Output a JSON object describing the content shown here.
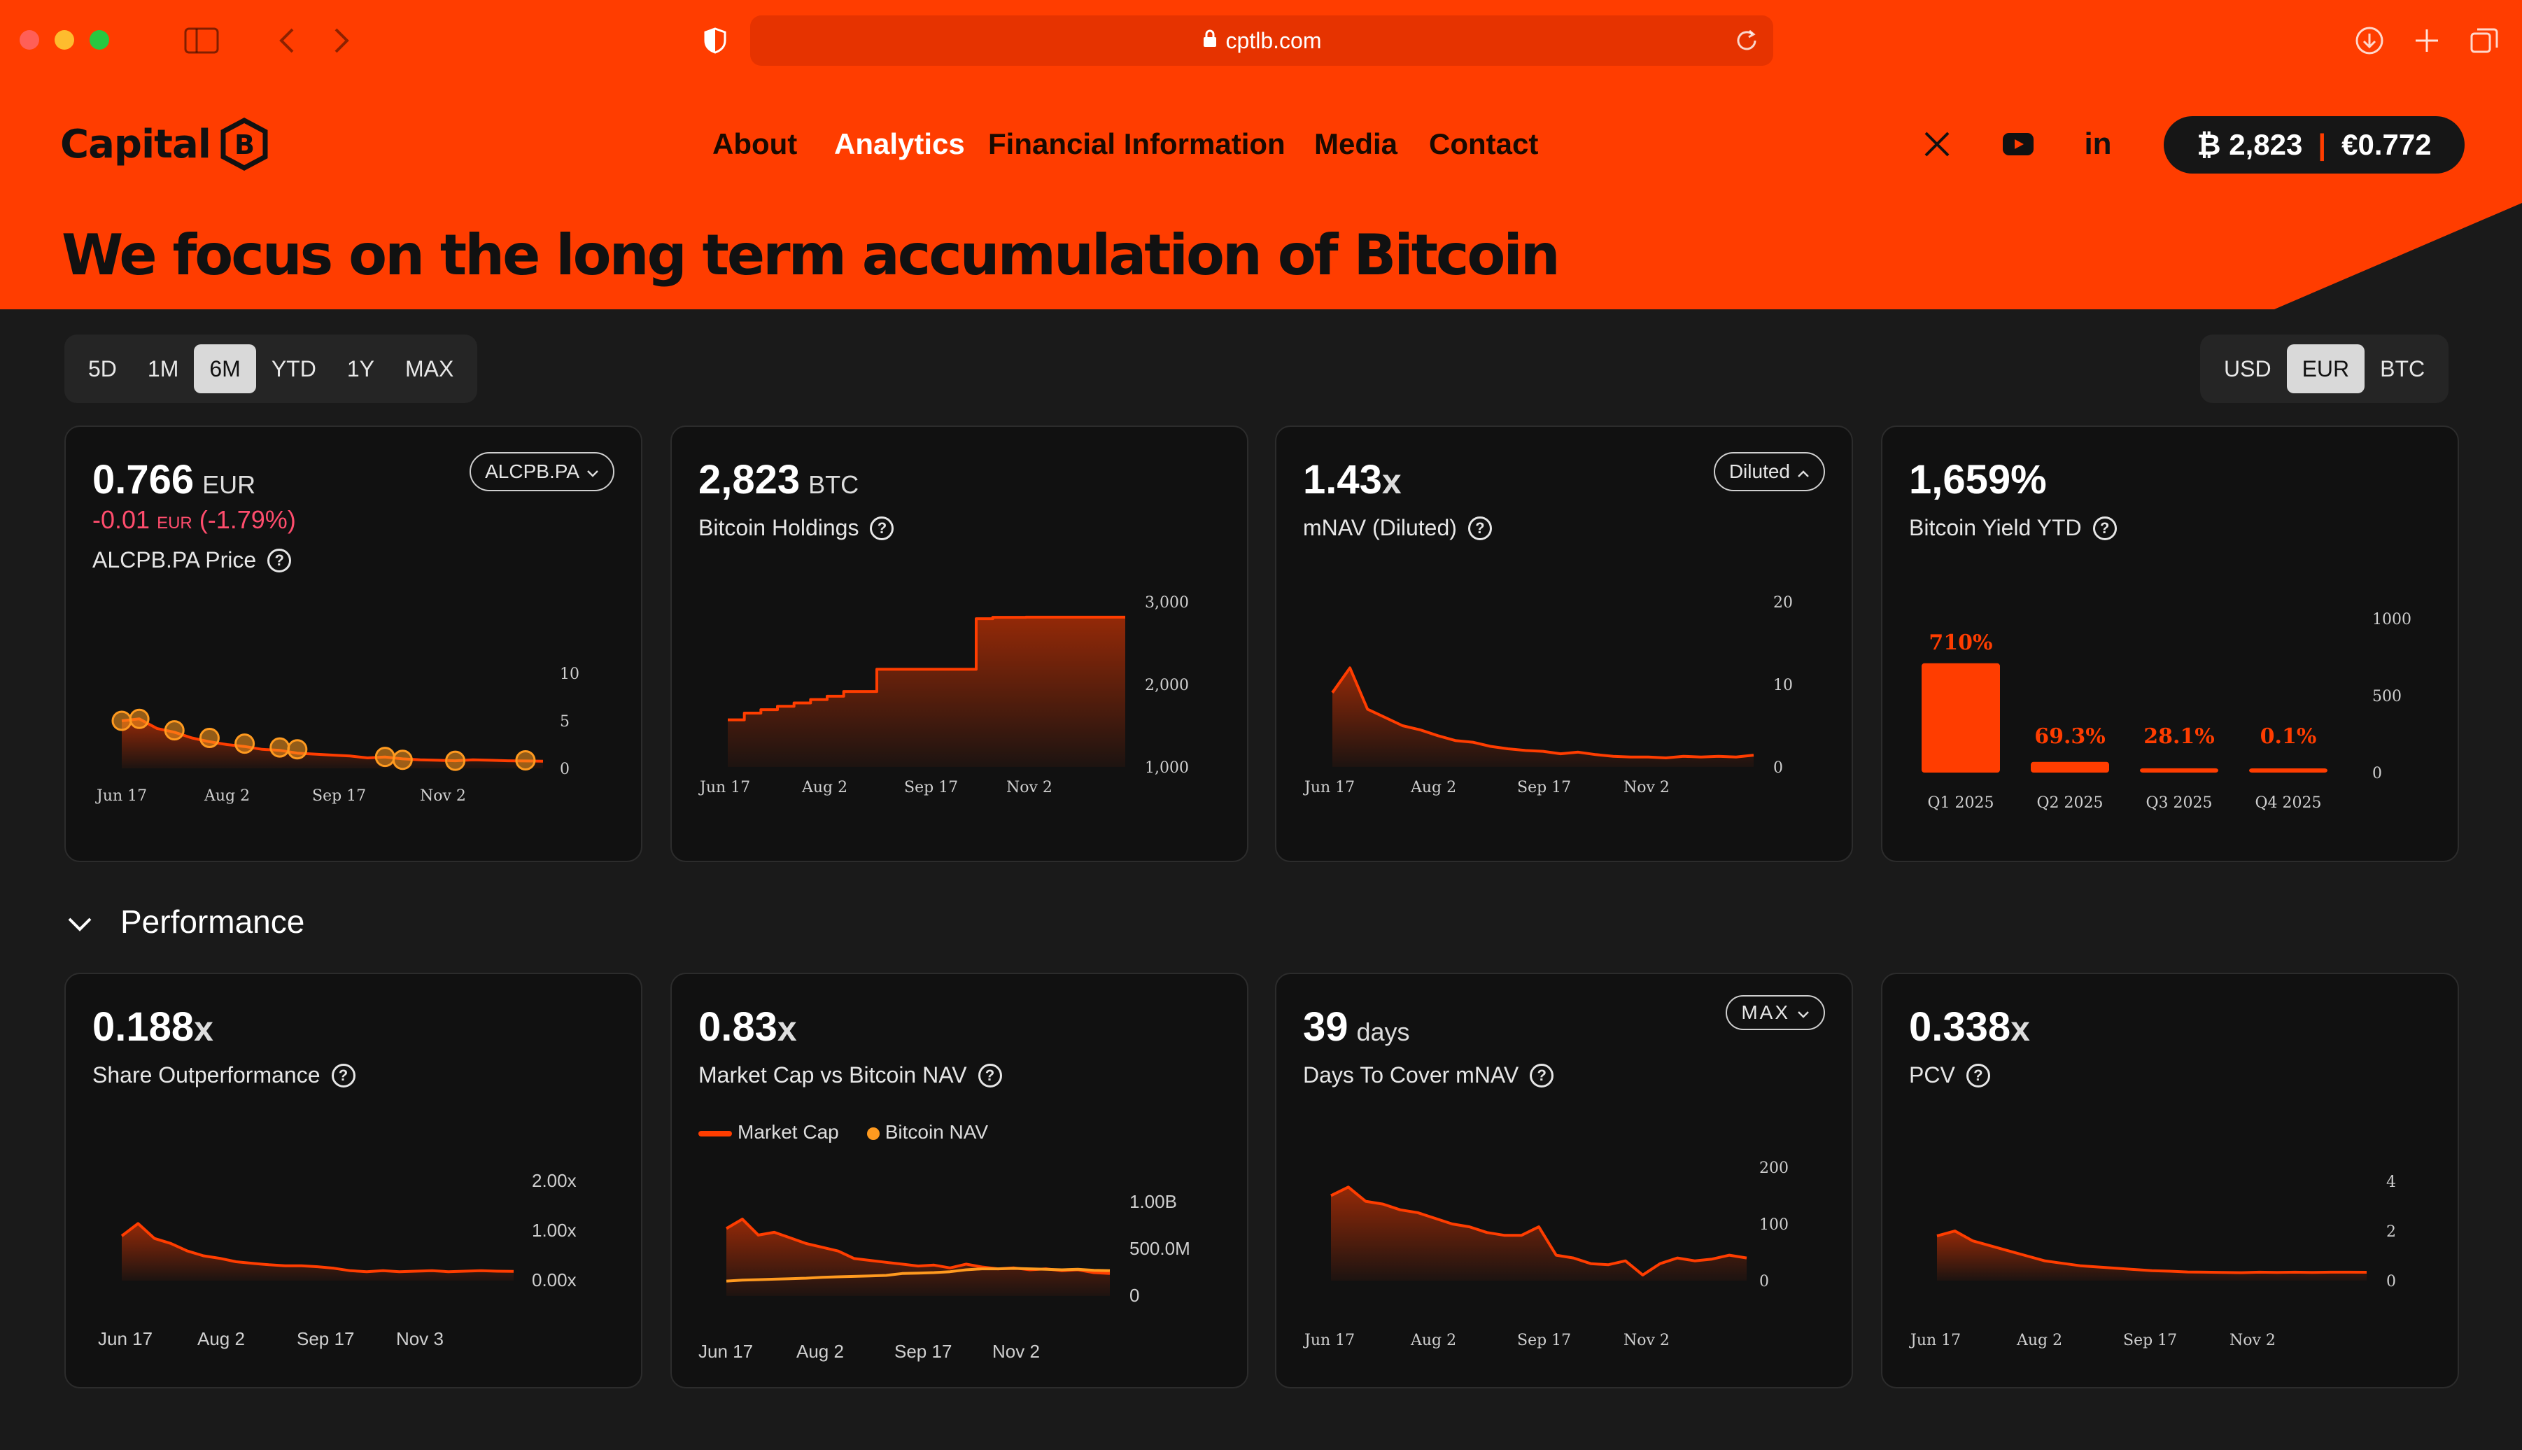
{
  "browser": {
    "url": "cptlb.com"
  },
  "header": {
    "logo": "Capital",
    "nav": [
      {
        "label": "About",
        "active": false
      },
      {
        "label": "Analytics",
        "active": true
      },
      {
        "label": "Financial Information",
        "active": false
      },
      {
        "label": "Media",
        "active": false
      },
      {
        "label": "Contact",
        "active": false
      }
    ],
    "social": [
      "x-icon",
      "youtube-icon",
      "linkedin-icon"
    ],
    "ticker": {
      "btc": "₿ 2,823",
      "price": "€0.772"
    },
    "headline": "We focus on the long term accumulation of Bitcoin"
  },
  "periods": [
    "5D",
    "1M",
    "6M",
    "YTD",
    "1Y",
    "MAX"
  ],
  "period_selected": "6M",
  "currencies": [
    "USD",
    "EUR",
    "BTC"
  ],
  "currency_selected": "EUR",
  "colors": {
    "accent": "#ff3d00",
    "background": "#1a1a1a",
    "card": "#111111",
    "negative": "#ff4d6d",
    "secondary_series": "#ff9a1f"
  },
  "cards": {
    "price": {
      "value": "0.766",
      "unit": "EUR",
      "change_value": "-0.01",
      "change_unit": "EUR",
      "change_pct": "(-1.79%)",
      "label": "ALCPB.PA Price",
      "chip": "ALCPB.PA"
    },
    "holdings": {
      "value": "2,823",
      "unit": "BTC",
      "label": "Bitcoin Holdings"
    },
    "mnav": {
      "value": "1.43",
      "unit": "x",
      "label": "mNAV (Diluted)",
      "chip": "Diluted"
    },
    "yield": {
      "value": "1,659%",
      "label": "Bitcoin Yield YTD"
    },
    "outperf": {
      "value": "0.188",
      "unit": "x",
      "label": "Share Outperformance"
    },
    "mcap": {
      "value": "0.83",
      "unit": "x",
      "label": "Market Cap vs Bitcoin NAV",
      "legend": [
        "Market Cap",
        "Bitcoin NAV"
      ]
    },
    "days": {
      "value": "39",
      "unit": "days",
      "label": "Days To Cover mNAV",
      "chip": "MAX"
    },
    "pcv": {
      "value": "0.338",
      "unit": "x",
      "label": "PCV"
    }
  },
  "section_title": "Performance",
  "chart_data": [
    {
      "id": "price",
      "type": "line",
      "x": [
        "Jun 17",
        "Aug 2",
        "Sep 17",
        "Nov 2"
      ],
      "yticks": [
        "0",
        "5",
        "10"
      ],
      "ylim": [
        0,
        10
      ],
      "values": [
        5.0,
        5.2,
        4.2,
        3.8,
        3.2,
        2.8,
        2.5,
        2.3,
        2.0,
        1.9,
        1.6,
        1.5,
        1.4,
        1.3,
        1.1,
        1.2,
        1.0,
        0.9,
        0.85,
        0.8,
        0.9,
        0.85,
        0.8,
        0.78,
        0.76
      ],
      "markers": [
        {
          "i": 0,
          "v": 5.0
        },
        {
          "i": 1,
          "v": 5.2
        },
        {
          "i": 3,
          "v": 4.0
        },
        {
          "i": 5,
          "v": 3.2
        },
        {
          "i": 7,
          "v": 2.6
        },
        {
          "i": 9,
          "v": 2.2
        },
        {
          "i": 10,
          "v": 2.0
        },
        {
          "i": 15,
          "v": 1.2
        },
        {
          "i": 16,
          "v": 0.9
        },
        {
          "i": 19,
          "v": 0.8
        },
        {
          "i": 23,
          "v": 0.85
        }
      ]
    },
    {
      "id": "holdings",
      "type": "area",
      "x": [
        "Jun 17",
        "Aug 2",
        "Sep 17",
        "Nov 2"
      ],
      "yticks": [
        "1,000",
        "2,000",
        "3,000"
      ],
      "ylim": [
        600,
        3050
      ],
      "values": [
        1300,
        1400,
        1450,
        1500,
        1550,
        1600,
        1650,
        1720,
        1720,
        2050,
        2050,
        2050,
        2050,
        2050,
        2050,
        2800,
        2820,
        2820,
        2823,
        2823,
        2823,
        2823,
        2823,
        2823,
        2823
      ]
    },
    {
      "id": "mnav",
      "type": "area",
      "x": [
        "Jun 17",
        "Aug 2",
        "Sep 17",
        "Nov 2"
      ],
      "yticks": [
        "0",
        "10",
        "20"
      ],
      "ylim": [
        0,
        20
      ],
      "values": [
        9,
        12,
        7,
        6,
        5,
        4.5,
        3.8,
        3.2,
        3,
        2.5,
        2.2,
        2.0,
        1.9,
        1.6,
        1.8,
        1.5,
        1.3,
        1.2,
        1.2,
        1.1,
        1.3,
        1.2,
        1.3,
        1.2,
        1.43
      ]
    },
    {
      "id": "yield",
      "type": "bar",
      "categories": [
        "Q1 2025",
        "Q2 2025",
        "Q3 2025",
        "Q4 2025"
      ],
      "values": [
        710,
        69.3,
        28.1,
        0.1
      ],
      "labels": [
        "710%",
        "69.3%",
        "28.1%",
        "0.1%"
      ],
      "yticks": [
        "0",
        "500",
        "1000"
      ],
      "ylim": [
        0,
        1000
      ]
    },
    {
      "id": "outperf",
      "type": "area",
      "x": [
        "Jun 17",
        "Aug 2",
        "Sep 17",
        "Nov 3"
      ],
      "yticks": [
        "0.00x",
        "1.00x",
        "2.00x"
      ],
      "ylim": [
        0,
        2
      ],
      "values": [
        0.9,
        1.15,
        0.85,
        0.75,
        0.6,
        0.5,
        0.45,
        0.38,
        0.35,
        0.32,
        0.3,
        0.3,
        0.28,
        0.25,
        0.2,
        0.18,
        0.2,
        0.18,
        0.19,
        0.2,
        0.18,
        0.19,
        0.2,
        0.19,
        0.188
      ]
    },
    {
      "id": "mcap",
      "type": "area",
      "x": [
        "Jun 17",
        "Aug 2",
        "Sep 17",
        "Nov 2"
      ],
      "yticks": [
        "0",
        "500.0M",
        "1.00B"
      ],
      "ylim": [
        0,
        1000000000
      ],
      "series": [
        {
          "name": "Market Cap",
          "values": [
            720,
            820,
            650,
            680,
            620,
            560,
            520,
            480,
            400,
            380,
            360,
            340,
            320,
            330,
            300,
            340,
            310,
            290,
            300,
            280,
            290,
            270,
            280,
            250,
            240
          ]
        },
        {
          "name": "Bitcoin NAV",
          "values": [
            160,
            170,
            175,
            180,
            185,
            190,
            200,
            205,
            210,
            215,
            220,
            240,
            245,
            250,
            260,
            280,
            290,
            290,
            295,
            290,
            285,
            280,
            285,
            275,
            270
          ]
        }
      ]
    },
    {
      "id": "days",
      "type": "area",
      "x": [
        "Jun 17",
        "Aug 2",
        "Sep 17",
        "Nov 2"
      ],
      "yticks": [
        "0",
        "100",
        "200"
      ],
      "ylim": [
        0,
        200
      ],
      "values": [
        150,
        165,
        140,
        135,
        125,
        120,
        110,
        100,
        95,
        85,
        80,
        80,
        95,
        45,
        40,
        30,
        28,
        35,
        10,
        30,
        40,
        35,
        38,
        45,
        40
      ]
    },
    {
      "id": "pcv",
      "type": "area",
      "x": [
        "Jun 17",
        "Aug 2",
        "Sep 17",
        "Nov 2"
      ],
      "yticks": [
        "0",
        "2",
        "4"
      ],
      "ylim": [
        0,
        4
      ],
      "values": [
        1.8,
        2.0,
        1.6,
        1.4,
        1.2,
        1.0,
        0.8,
        0.7,
        0.6,
        0.55,
        0.5,
        0.45,
        0.4,
        0.38,
        0.35,
        0.34,
        0.33,
        0.32,
        0.34,
        0.33,
        0.34,
        0.33,
        0.34,
        0.34,
        0.338
      ]
    }
  ]
}
